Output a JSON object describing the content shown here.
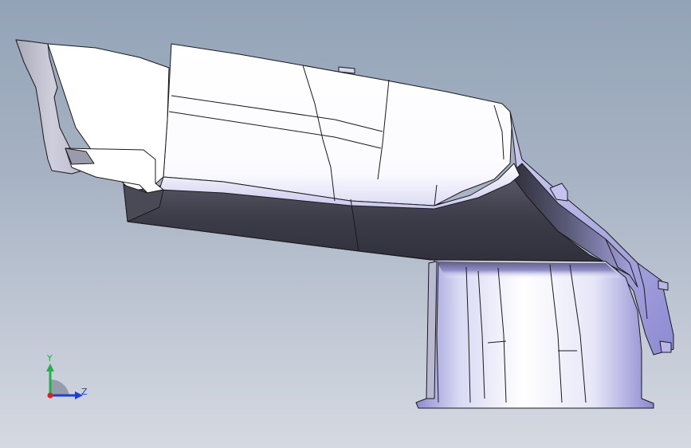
{
  "viewport": {
    "background_top": "#93a3b7",
    "background_bottom": "#d5d9e1",
    "edge_color": "#1a1a1a",
    "face_light": "#ffffff",
    "face_shadow": "#3c3c4a",
    "face_tint": "#9a98d8"
  },
  "triad": {
    "y_label": "Y",
    "z_label": "Z",
    "y_color": "#22b14c",
    "z_color": "#1f3fd0",
    "x_color": "#e02020"
  }
}
